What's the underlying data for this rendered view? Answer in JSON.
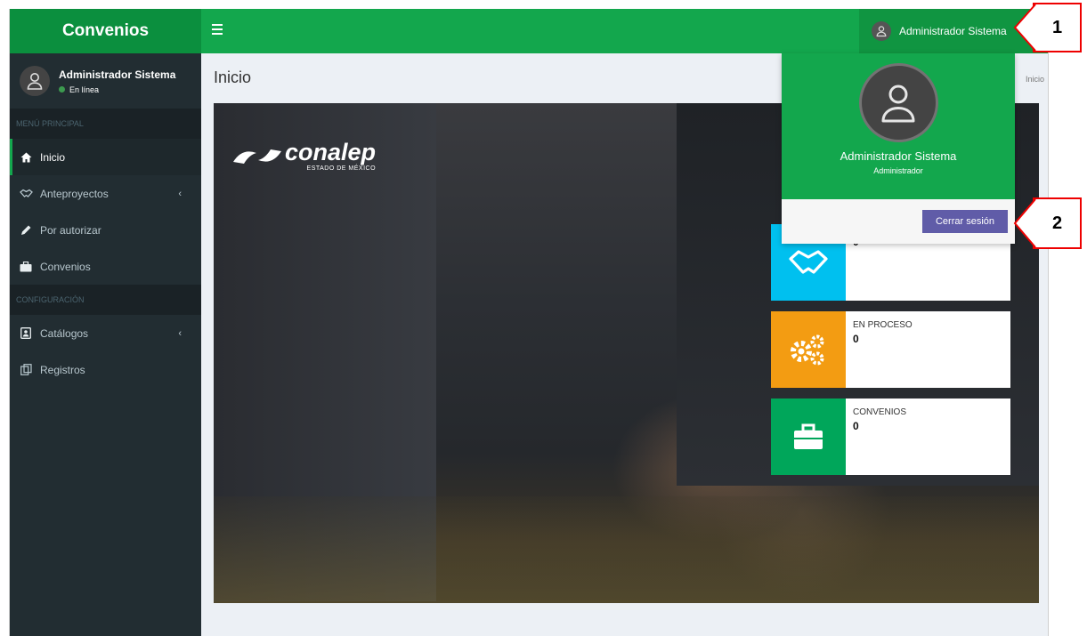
{
  "app": {
    "title": "Convenios"
  },
  "header": {
    "user_name": "Administrador Sistema"
  },
  "sidebar": {
    "user": {
      "name": "Administrador Sistema",
      "status": "En línea"
    },
    "sections": [
      {
        "header": "MENÚ PRINCIPAL"
      },
      {
        "header": "CONFIGURACIÓN"
      }
    ],
    "items": [
      {
        "label": "Inicio",
        "icon": "home-icon"
      },
      {
        "label": "Anteproyectos",
        "icon": "handshake-icon"
      },
      {
        "label": "Por autorizar",
        "icon": "pencil-icon"
      },
      {
        "label": "Convenios",
        "icon": "briefcase-icon"
      },
      {
        "label": "Catálogos",
        "icon": "catalog-icon"
      },
      {
        "label": "Registros",
        "icon": "registros-icon"
      }
    ]
  },
  "main": {
    "title": "Inicio",
    "breadcrumb": "Inicio",
    "logo": {
      "word": "conalep",
      "sub": "ESTADO DE MÉXICO"
    },
    "info_boxes": [
      {
        "label": "",
        "value": "0",
        "color": "#00c0ef",
        "icon": "handshake-icon"
      },
      {
        "label": "EN PROCESO",
        "value": "0",
        "color": "#f39c12",
        "icon": "gears-icon"
      },
      {
        "label": "CONVENIOS",
        "value": "0",
        "color": "#00a65a",
        "icon": "briefcase-icon"
      }
    ]
  },
  "dropdown": {
    "name": "Administrador Sistema",
    "role": "Administrador",
    "logout_label": "Cerrar sesión"
  },
  "callouts": [
    "1",
    "2"
  ],
  "colors": {
    "brand": "#13a74d",
    "sidebar": "#222d32",
    "logout": "#605ca8",
    "callout": "#e00000"
  }
}
